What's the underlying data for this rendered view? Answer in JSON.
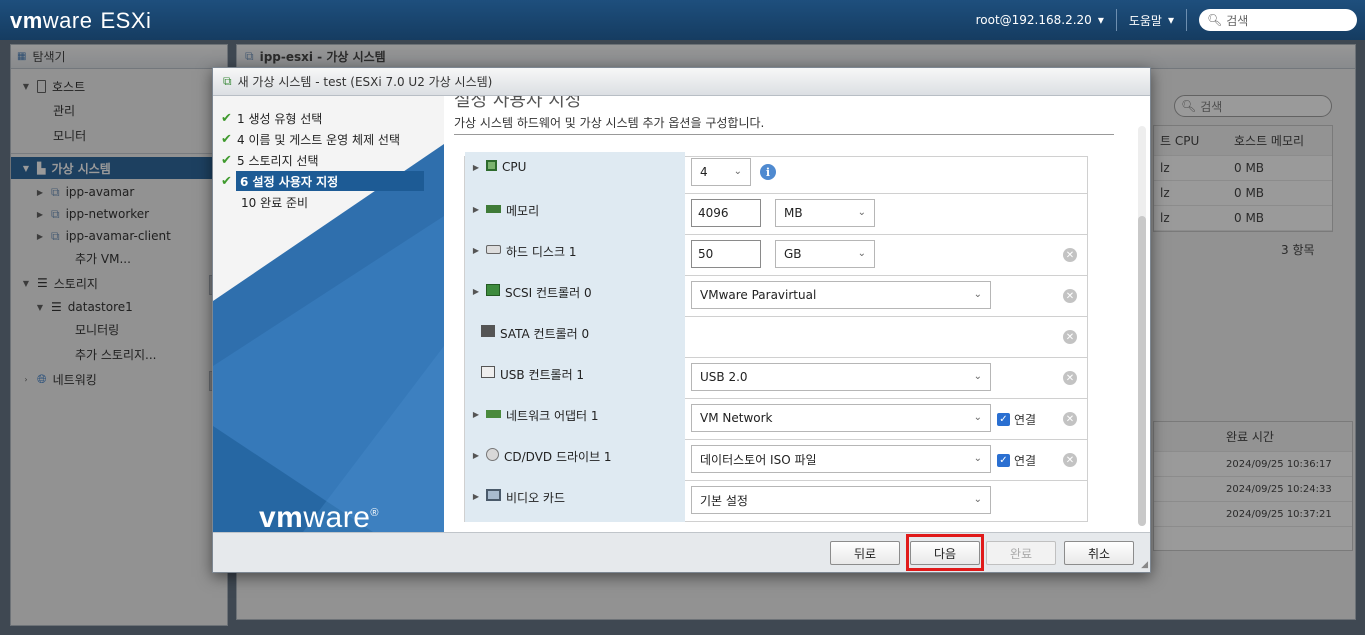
{
  "topbar": {
    "brand_vm": "vm",
    "brand_ware": "ware",
    "brand_product": "ESXi",
    "user": "root@192.168.2.20",
    "help": "도움말",
    "search_placeholder": "검색"
  },
  "navigator": {
    "title": "탐색기",
    "items": [
      {
        "label": "호스트"
      },
      {
        "label": "관리"
      },
      {
        "label": "모니터"
      },
      {
        "label": "가상 시스템"
      },
      {
        "label": "ipp-avamar"
      },
      {
        "label": "ipp-networker"
      },
      {
        "label": "ipp-avamar-client"
      },
      {
        "label": "추가 VM..."
      },
      {
        "label": "스토리지"
      },
      {
        "label": "datastore1"
      },
      {
        "label": "모니터링"
      },
      {
        "label": "추가 스토리지..."
      },
      {
        "label": "네트워킹"
      }
    ]
  },
  "main": {
    "title": "ipp-esxi - 가상 시스템",
    "search_placeholder": "검색",
    "columns": [
      "트 CPU",
      "호스트 메모리"
    ],
    "rows": [
      {
        "cpu": "lz",
        "mem": "0 MB"
      },
      {
        "cpu": "lz",
        "mem": "0 MB"
      },
      {
        "cpu": "lz",
        "mem": "0 MB"
      }
    ],
    "count": "3 항목",
    "tasks_column": "완료 시간",
    "tasks": [
      "2024/09/25 10:36:17",
      "2024/09/25 10:24:33",
      "2024/09/25 10:37:21"
    ]
  },
  "dialog": {
    "title": "새 가상 시스템 - test (ESXi 7.0 U2 가상 시스템)",
    "steps": [
      {
        "label": "1 생성 유형 선택",
        "done": true
      },
      {
        "label": "4 이름 및 게스트 운영 체제 선택",
        "done": true
      },
      {
        "label": "5 스토리지 선택",
        "done": true
      },
      {
        "label": "6 설정 사용자 지정",
        "done": true
      },
      {
        "label": "10 완료 준비",
        "done": false
      }
    ],
    "logo_vm": "vm",
    "logo_ware": "ware",
    "cut_title": "설정 사용자 지정",
    "description": "가상 시스템 하드웨어 및 가상 시스템 추가 옵션을 구성합니다.",
    "hardware": {
      "cpu": {
        "label": "CPU",
        "value": "4"
      },
      "memory": {
        "label": "메모리",
        "value": "4096",
        "unit": "MB"
      },
      "disk": {
        "label": "하드 디스크 1",
        "value": "50",
        "unit": "GB"
      },
      "scsi": {
        "label": "SCSI 컨트롤러 0",
        "value": "VMware Paravirtual"
      },
      "sata": {
        "label": "SATA 컨트롤러 0"
      },
      "usb": {
        "label": "USB 컨트롤러 1",
        "value": "USB 2.0"
      },
      "net": {
        "label": "네트워크 어댑터 1",
        "value": "VM Network",
        "connect": "연결"
      },
      "cd": {
        "label": "CD/DVD 드라이브 1",
        "value": "데이터스토어 ISO 파일",
        "connect": "연결"
      },
      "video": {
        "label": "비디오 카드",
        "value": "기본 설정"
      }
    },
    "buttons": {
      "back": "뒤로",
      "next": "다음",
      "finish": "완료",
      "cancel": "취소"
    }
  }
}
